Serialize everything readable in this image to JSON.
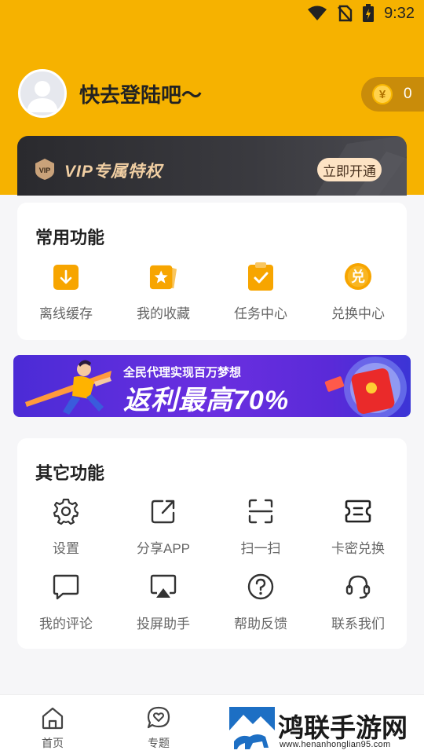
{
  "status_bar": {
    "time": "9:32"
  },
  "header": {
    "login_prompt": "快去登陆吧～",
    "coin_symbol": "¥",
    "coin_count": "0"
  },
  "vip": {
    "badge": "VIP",
    "title": "VIP专属特权",
    "button": "立即开通"
  },
  "common_functions": {
    "title": "常用功能",
    "items": [
      {
        "label": "离线缓存",
        "icon": "download-icon"
      },
      {
        "label": "我的收藏",
        "icon": "star-bookmark-icon"
      },
      {
        "label": "任务中心",
        "icon": "clipboard-check-icon"
      },
      {
        "label": "兑换中心",
        "icon": "exchange-icon",
        "glyph": "兑"
      }
    ]
  },
  "banner": {
    "subtitle": "全民代理实现百万梦想",
    "headline": "返利最高70%"
  },
  "other_functions": {
    "title": "其它功能",
    "items": [
      {
        "label": "设置",
        "icon": "gear-icon"
      },
      {
        "label": "分享APP",
        "icon": "share-icon"
      },
      {
        "label": "扫一扫",
        "icon": "scan-icon"
      },
      {
        "label": "卡密兑换",
        "icon": "ticket-icon"
      },
      {
        "label": "我的评论",
        "icon": "comment-icon"
      },
      {
        "label": "投屏助手",
        "icon": "cast-screen-icon"
      },
      {
        "label": "帮助反馈",
        "icon": "help-icon"
      },
      {
        "label": "联系我们",
        "icon": "headset-icon"
      }
    ]
  },
  "tabbar": {
    "items": [
      {
        "label": "首页",
        "icon": "home-icon"
      },
      {
        "label": "专题",
        "icon": "heart-chat-icon"
      }
    ]
  },
  "watermark": {
    "text": "鸿联手游网",
    "url": "www.henanhonglian95.com"
  },
  "colors": {
    "brand_yellow": "#f6b200",
    "accent_orange": "#f7a500",
    "vip_gold": "#f1cfa3"
  }
}
